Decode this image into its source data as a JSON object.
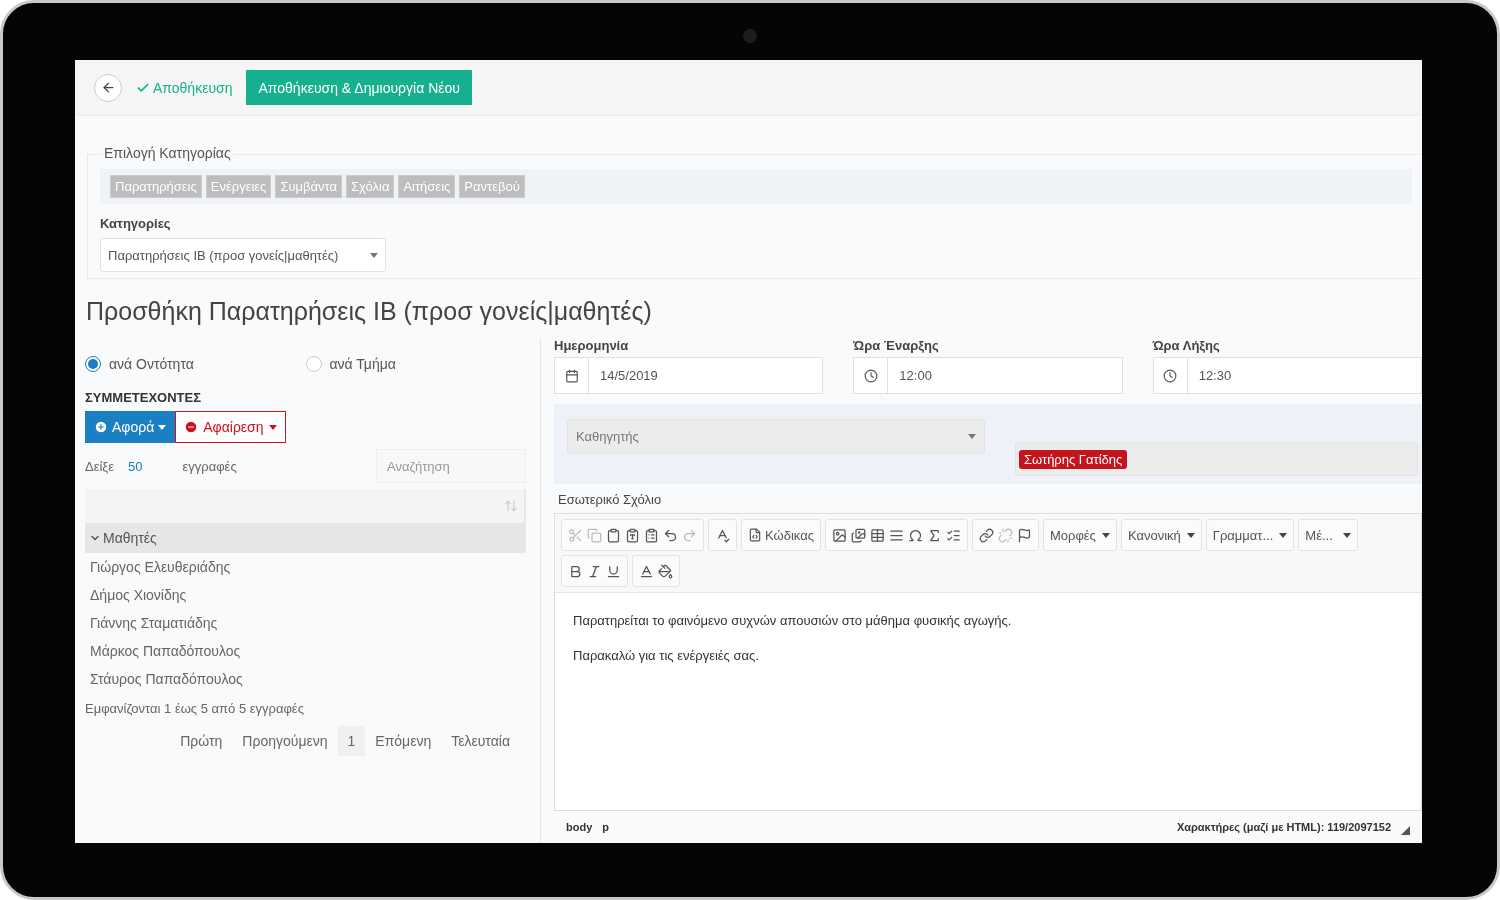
{
  "header": {
    "save_link": "Αποθήκευση",
    "save_new_button": "Αποθήκευση & Δημιουργία Νέου"
  },
  "category": {
    "legend": "Επιλογή Κατηγορίας",
    "tabs": [
      "Παρατηρήσεις",
      "Ενέργειες",
      "Συμβάντα",
      "Σχόλια",
      "Αιτήσεις",
      "Ραντεβού"
    ],
    "label": "Κατηγορίες",
    "select_value": "Παρατηρήσεις ΙΒ (προσ γονείς|μαθητές)"
  },
  "title": "Προσθήκη Παρατηρήσεις ΙΒ (προσ γονείς|μαθητές)",
  "mode_options": [
    {
      "label": "ανά Οντότητα",
      "selected": true
    },
    {
      "label": "ανά Τμήμα",
      "selected": false
    }
  ],
  "participants": {
    "heading": "ΣΥΜΜΕΤΕΧΟΝΤΕΣ",
    "add_button": "Αφορά",
    "remove_button": "Αφαίρεση",
    "show_label": "Δείξε",
    "page_size": "50",
    "records_label": "εγγραφές",
    "search_placeholder": "Αναζήτηση",
    "group": {
      "label": "Μαθητές",
      "expanded": true,
      "children": [
        "Γιώργος Ελευθεριάδης",
        "Δήμος Χιονίδης",
        "Γιάννης Σταματιάδης",
        "Μάρκος Παπαδόπουλος",
        "Στάυρος Παπαδόπουλος"
      ]
    },
    "info": "Εμφανίζονται 1 έως 5 από 5 εγγραφές",
    "pagination": [
      {
        "label": "Πρώτη",
        "selected": false
      },
      {
        "label": "Προηγούμενη",
        "selected": false
      },
      {
        "label": "1",
        "selected": true
      },
      {
        "label": "Επόμενη",
        "selected": false
      },
      {
        "label": "Τελευταία",
        "selected": false
      }
    ]
  },
  "fields": [
    {
      "label": "Ημερομηνία",
      "value": "14/5/2019",
      "kind": "date"
    },
    {
      "label": "Ώρα Έναρξης",
      "value": "12:00",
      "kind": "time"
    },
    {
      "label": "Ώρα Λήξης",
      "value": "12:30",
      "kind": "time"
    }
  ],
  "teacher_select": {
    "placeholder": "Καθηγητής"
  },
  "tags": [
    {
      "label": "Σωτήρης Γατίδης"
    }
  ],
  "comment": {
    "label": "Εσωτερικό Σχόλιο",
    "code_button": "Κώδικας",
    "dropdowns": [
      "Μορφές",
      "Κανονική",
      "Γραμματ...",
      "Μέ..."
    ],
    "paragraphs": [
      "Παρατηρείται το φαινόμενο συχνών απουσιών στο μάθημα φυσικής αγωγής.",
      "Παρακαλώ για τις ενέργειές σας."
    ],
    "path": [
      "body",
      "p"
    ],
    "char_count": "Χαρακτήρες (μαζί με HTML): 119/2097152"
  }
}
